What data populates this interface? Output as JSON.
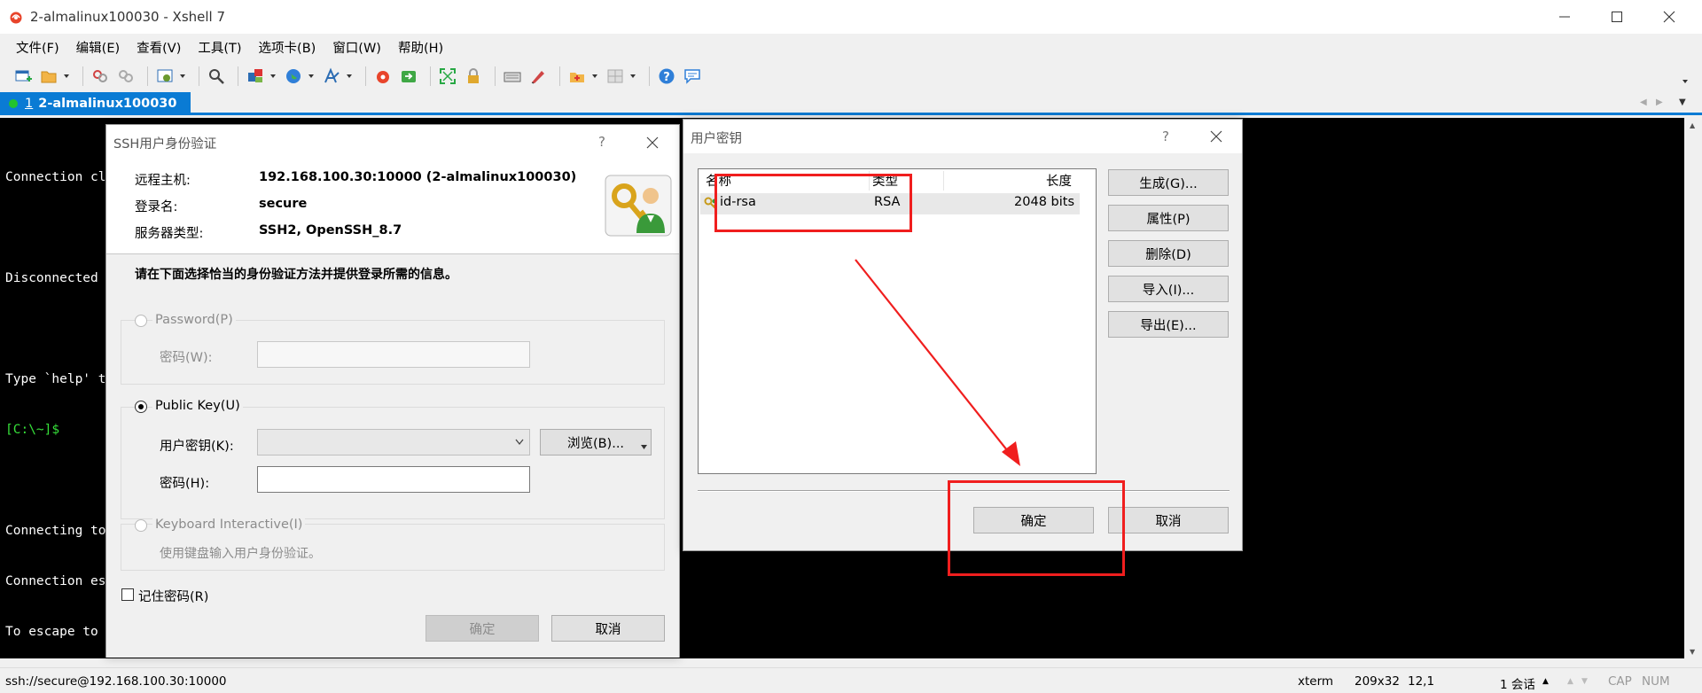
{
  "window": {
    "title": "2-almalinux100030 - Xshell 7",
    "icon": "xshell-app-icon"
  },
  "menu": [
    "文件(F)",
    "编辑(E)",
    "查看(V)",
    "工具(T)",
    "选项卡(B)",
    "窗口(W)",
    "帮助(H)"
  ],
  "tab": {
    "number": "1",
    "label": "2-almalinux100030"
  },
  "terminal": {
    "lines": [
      "Connection cl",
      "",
      "Disconnected ",
      "",
      "Type `help' t",
      "[C:\\~]$",
      "",
      "Connecting to",
      "Connection es",
      "To escape to "
    ],
    "prompt_color": "#36e03a"
  },
  "status": {
    "address": "ssh://secure@192.168.100.30:10000",
    "term": "xterm",
    "size": "209x32",
    "pos": "12,1",
    "sessions": "1 会话",
    "cap": "CAP",
    "num": "NUM"
  },
  "auth_dialog": {
    "title": "SSH用户身份验证",
    "help": "?",
    "remote_host_label": "远程主机:",
    "remote_host_value": "192.168.100.30:10000 (2-almalinux100030)",
    "login_label": "登录名:",
    "login_value": "secure",
    "server_type_label": "服务器类型:",
    "server_type_value": "SSH2, OpenSSH_8.7",
    "instruction": "请在下面选择恰当的身份验证方法并提供登录所需的信息。",
    "password_option": "Password(P)",
    "password_field_label": "密码(W):",
    "publickey_option": "Public Key(U)",
    "user_key_label": "用户密钥(K):",
    "user_key_value": "",
    "browse_button": "浏览(B)...",
    "passphrase_label": "密码(H):",
    "passphrase_value": "",
    "keyboard_option": "Keyboard Interactive(I)",
    "keyboard_desc": "使用键盘输入用户身份验证。",
    "remember_label": "记住密码(R)",
    "ok_button": "确定",
    "cancel_button": "取消"
  },
  "key_dialog": {
    "title": "用户密钥",
    "help": "?",
    "columns": [
      "名称",
      "类型",
      "长度"
    ],
    "rows": [
      {
        "name": "id-rsa",
        "type": "RSA",
        "length": "2048 bits"
      }
    ],
    "buttons": {
      "generate": "生成(G)...",
      "properties": "属性(P)",
      "delete": "删除(D)",
      "import": "导入(I)...",
      "export": "导出(E)..."
    },
    "ok_button": "确定",
    "cancel_button": "取消"
  },
  "annotation_color": "#f01e1e"
}
